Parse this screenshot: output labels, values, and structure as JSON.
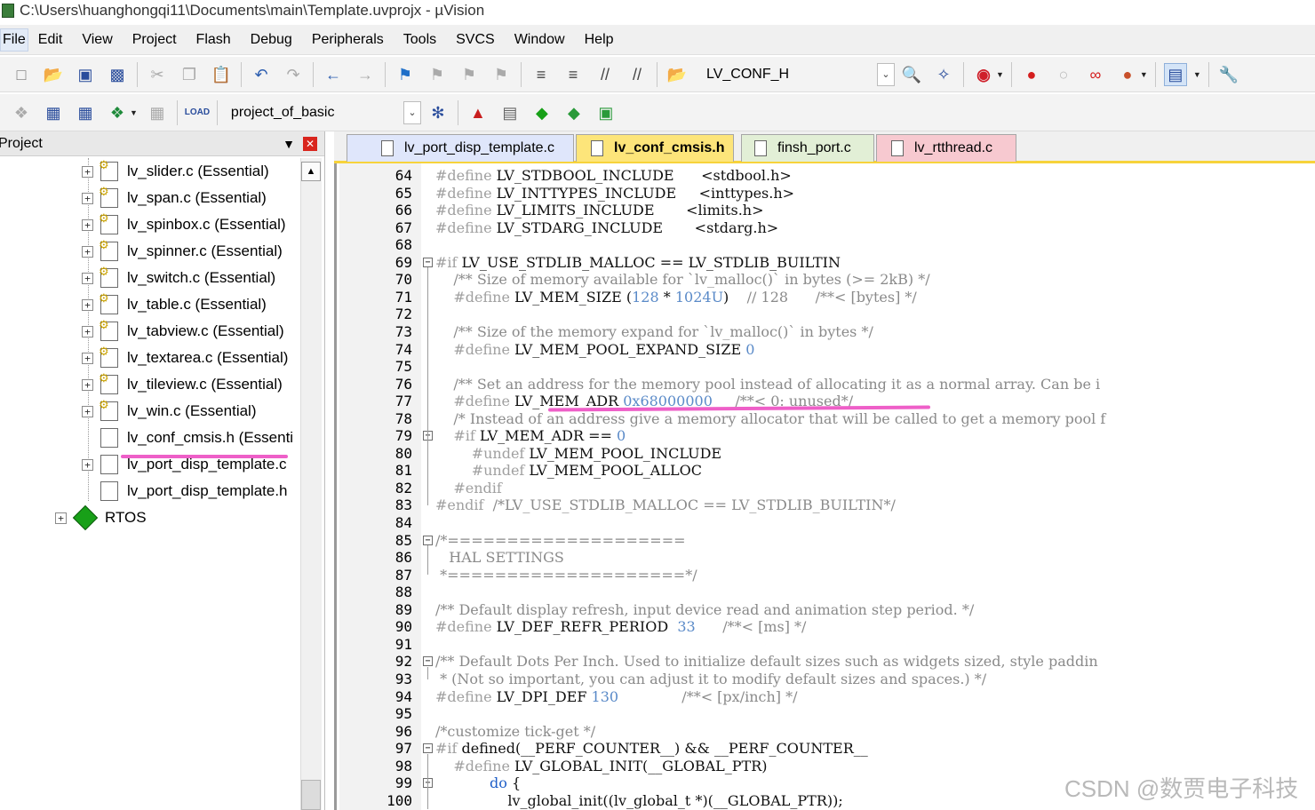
{
  "window": {
    "title": "C:\\Users\\huanghongqi11\\Documents\\main\\Template.uvprojx - µVision"
  },
  "menu": [
    "File",
    "Edit",
    "View",
    "Project",
    "Flash",
    "Debug",
    "Peripherals",
    "Tools",
    "SVCS",
    "Window",
    "Help"
  ],
  "toolbar1": {
    "target_combo": "LV_CONF_H"
  },
  "toolbar2": {
    "project_combo": "project_of_basic"
  },
  "project_panel": {
    "title": "Project",
    "items": [
      "lv_slider.c (Essential)",
      "lv_span.c (Essential)",
      "lv_spinbox.c (Essential)",
      "lv_spinner.c (Essential)",
      "lv_switch.c (Essential)",
      "lv_table.c (Essential)",
      "lv_tabview.c (Essential)",
      "lv_textarea.c (Essential)",
      "lv_tileview.c (Essential)",
      "lv_win.c (Essential)",
      "lv_conf_cmsis.h (Essenti",
      "lv_port_disp_template.c",
      "lv_port_disp_template.h",
      "RTOS"
    ]
  },
  "tabs": [
    {
      "label": "lv_port_disp_template.c",
      "color": "#dfe6fb"
    },
    {
      "label": "lv_conf_cmsis.h",
      "color": "#fde57a"
    },
    {
      "label": "finsh_port.c",
      "color": "#e2efd6"
    },
    {
      "label": "lv_rtthread.c",
      "color": "#f7c9d0"
    }
  ],
  "code": {
    "line_numbers": [
      "64",
      "65",
      "66",
      "67",
      "68",
      "69",
      "70",
      "71",
      "72",
      "73",
      "74",
      "75",
      "76",
      "77",
      "78",
      "79",
      "80",
      "81",
      "82",
      "83",
      "84",
      "85",
      "86",
      "87",
      "88",
      "89",
      "90",
      "91",
      "92",
      "93",
      "94",
      "95",
      "96",
      "97",
      "98",
      "99",
      "100"
    ],
    "lines": [
      "#define LV_STDBOOL_INCLUDE      <stdbool.h>",
      "#define LV_INTTYPES_INCLUDE     <inttypes.h>",
      "#define LV_LIMITS_INCLUDE       <limits.h>",
      "#define LV_STDARG_INCLUDE       <stdarg.h>",
      "",
      "#if LV_USE_STDLIB_MALLOC == LV_STDLIB_BUILTIN",
      "    /** Size of memory available for `lv_malloc()` in bytes (>= 2kB) */",
      "    #define LV_MEM_SIZE (128 * 1024U)    // 128      /**< [bytes] */",
      "",
      "    /** Size of the memory expand for `lv_malloc()` in bytes */",
      "    #define LV_MEM_POOL_EXPAND_SIZE 0",
      "",
      "    /** Set an address for the memory pool instead of allocating it as a normal array. Can be i",
      "    #define LV_MEM_ADR 0x68000000     /**< 0: unused*/",
      "    /* Instead of an address give a memory allocator that will be called to get a memory pool f",
      "    #if LV_MEM_ADR == 0",
      "        #undef LV_MEM_POOL_INCLUDE",
      "        #undef LV_MEM_POOL_ALLOC",
      "    #endif",
      "#endif  /*LV_USE_STDLIB_MALLOC == LV_STDLIB_BUILTIN*/",
      "",
      "/*====================",
      "   HAL SETTINGS",
      " *====================*/",
      "",
      "/** Default display refresh, input device read and animation step period. */",
      "#define LV_DEF_REFR_PERIOD  33      /**< [ms] */",
      "",
      "/** Default Dots Per Inch. Used to initialize default sizes such as widgets sized, style paddin",
      " * (Not so important, you can adjust it to modify default sizes and spaces.) */",
      "#define LV_DPI_DEF 130              /**< [px/inch] */",
      "",
      "/*customize tick-get */",
      "#if defined(__PERF_COUNTER__) && __PERF_COUNTER__",
      "    #define LV_GLOBAL_INIT(__GLOBAL_PTR)",
      "            do {",
      "                lv_global_init((lv_global_t *)(__GLOBAL_PTR));"
    ]
  },
  "watermark": "CSDN @数贾电子科技"
}
